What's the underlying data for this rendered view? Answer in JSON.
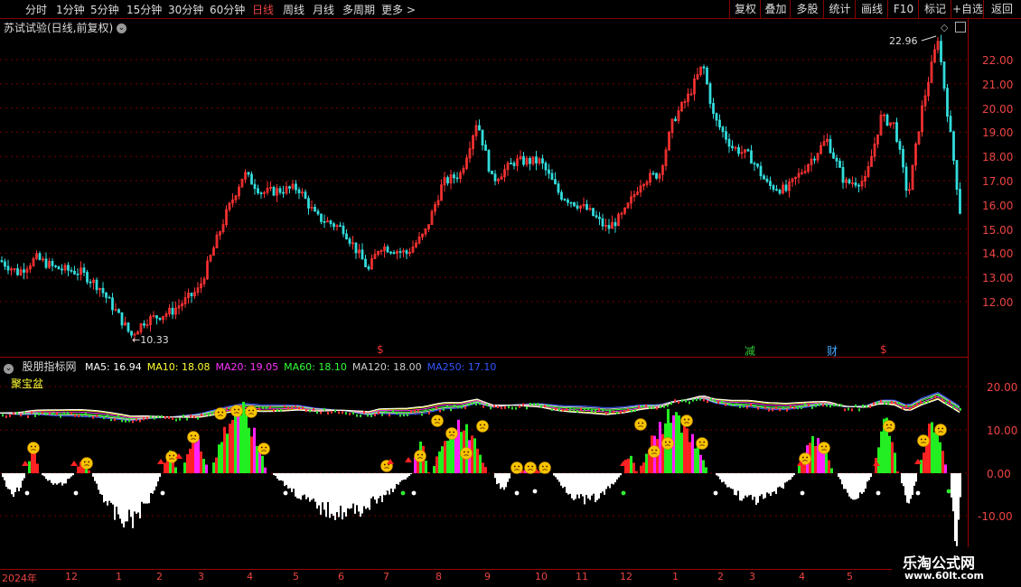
{
  "toolbar": {
    "periods": [
      "分时",
      "1分钟",
      "5分钟",
      "15分钟",
      "30分钟",
      "60分钟",
      "日线",
      "周线",
      "月线",
      "多周期",
      "更多 >"
    ],
    "active_period": "日线",
    "right_buttons": [
      "复权",
      "叠加",
      "多股",
      "统计",
      "画线",
      "F10",
      "标记",
      "+自选",
      "返回"
    ]
  },
  "main_chart": {
    "title": "苏试试验(日线,前复权)",
    "high_label": "22.96",
    "low_label": "10.33",
    "y_ticks": [
      "22.00",
      "21.00",
      "20.00",
      "19.00",
      "18.00",
      "17.00",
      "16.00",
      "15.00",
      "14.00",
      "13.00",
      "12.00"
    ],
    "markers": [
      {
        "text": "$",
        "color": "#e33"
      },
      {
        "text": "减",
        "color": "#3c3"
      },
      {
        "text": "财",
        "color": "#4af"
      },
      {
        "text": "$",
        "color": "#e33"
      }
    ]
  },
  "indicator": {
    "name": "股朋指标网",
    "ma": [
      {
        "label": "MA5: 16.94",
        "color": "#ffffff"
      },
      {
        "label": "MA10: 18.08",
        "color": "#ffff33"
      },
      {
        "label": "MA20: 19.05",
        "color": "#ff33ff"
      },
      {
        "label": "MA60: 18.10",
        "color": "#33ff33"
      },
      {
        "label": "MA120: 18.00",
        "color": "#cccccc"
      },
      {
        "label": "MA250: 17.10",
        "color": "#3355ff"
      }
    ],
    "subtitle": "聚宝盆",
    "y_ticks": [
      "20.00",
      "10.00",
      "0.00",
      "-10.00"
    ]
  },
  "x_axis": [
    "2024年",
    "12",
    "1",
    "2",
    "3",
    "4",
    "5",
    "6",
    "7",
    "8",
    "9",
    "10",
    "11",
    "12",
    "1",
    "2",
    "3",
    "4",
    "5"
  ],
  "watermark": {
    "line1": "乐淘公式网",
    "line2": "www.60lt.com"
  },
  "colors": {
    "up": "#ff3333",
    "down": "#33dddd",
    "grid": "#880000",
    "accent": "#ff3333"
  }
}
